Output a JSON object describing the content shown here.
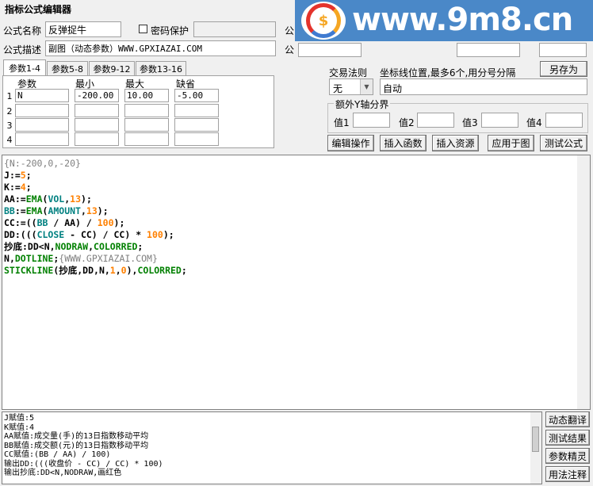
{
  "window": {
    "title": "指标公式编辑器"
  },
  "watermark": {
    "site": "www.9m8.cn"
  },
  "formula_name": {
    "label": "公式名称",
    "value": "反弹捉牛"
  },
  "password": {
    "label": "密码保护",
    "checked": false
  },
  "formula_desc": {
    "label": "公式描述",
    "value": "副图（动态参数）WWW.GPXIAZAI.COM"
  },
  "truncated_labels": {
    "top": "公",
    "mid": "公"
  },
  "tabs": [
    "参数1-4",
    "参数5-8",
    "参数9-12",
    "参数13-16"
  ],
  "params": {
    "headers": {
      "name": "参数",
      "min": "最小",
      "max": "最大",
      "default": "缺省"
    },
    "rows": [
      {
        "num": "1",
        "name": "N",
        "min": "-200.00",
        "max": "10.00",
        "default": "-5.00"
      },
      {
        "num": "2",
        "name": "",
        "min": "",
        "max": "",
        "default": ""
      },
      {
        "num": "3",
        "name": "",
        "min": "",
        "max": "",
        "default": ""
      },
      {
        "num": "4",
        "name": "",
        "min": "",
        "max": "",
        "default": ""
      }
    ]
  },
  "save_as_label": "另存为",
  "trade_rule": {
    "label": "交易法则",
    "value": "无"
  },
  "axis_pos": {
    "label": "坐标线位置,最多6个,用分号分隔",
    "value": "自动"
  },
  "extra_y": {
    "label": "额外Y轴分界",
    "v1": "值1",
    "v2": "值2",
    "v3": "值3",
    "v4": "值4"
  },
  "buttons": {
    "edit": "编辑操作",
    "insert_func": "插入函数",
    "insert_res": "插入资源",
    "apply": "应用于图",
    "test": "测试公式"
  },
  "code_lines": [
    [
      {
        "t": "{N:-200,0,-20}",
        "c": "gray"
      }
    ],
    [
      {
        "t": "J",
        "c": "black"
      },
      {
        "t": ":=",
        "c": "black"
      },
      {
        "t": "5",
        "c": "orange"
      },
      {
        "t": ";",
        "c": "black"
      }
    ],
    [
      {
        "t": "K",
        "c": "black"
      },
      {
        "t": ":=",
        "c": "black"
      },
      {
        "t": "4",
        "c": "orange"
      },
      {
        "t": ";",
        "c": "black"
      }
    ],
    [
      {
        "t": "AA",
        "c": "black"
      },
      {
        "t": ":=",
        "c": "black"
      },
      {
        "t": "EMA",
        "c": "green"
      },
      {
        "t": "(",
        "c": "black"
      },
      {
        "t": "VOL",
        "c": "teal"
      },
      {
        "t": ",",
        "c": "black"
      },
      {
        "t": "13",
        "c": "orange"
      },
      {
        "t": ");",
        "c": "black"
      }
    ],
    [
      {
        "t": "BB",
        "c": "teal"
      },
      {
        "t": ":=",
        "c": "black"
      },
      {
        "t": "EMA",
        "c": "green"
      },
      {
        "t": "(",
        "c": "black"
      },
      {
        "t": "AMOUNT",
        "c": "teal"
      },
      {
        "t": ",",
        "c": "black"
      },
      {
        "t": "13",
        "c": "orange"
      },
      {
        "t": ");",
        "c": "black"
      }
    ],
    [
      {
        "t": "CC",
        "c": "black"
      },
      {
        "t": ":=((",
        "c": "black"
      },
      {
        "t": "BB",
        "c": "teal"
      },
      {
        "t": " / AA) / ",
        "c": "black"
      },
      {
        "t": "100",
        "c": "orange"
      },
      {
        "t": ");",
        "c": "black"
      }
    ],
    [
      {
        "t": "DD",
        "c": "black"
      },
      {
        "t": ":(((",
        "c": "black"
      },
      {
        "t": "CLOSE",
        "c": "teal"
      },
      {
        "t": " - CC) / CC) * ",
        "c": "black"
      },
      {
        "t": "100",
        "c": "orange"
      },
      {
        "t": ");",
        "c": "black"
      }
    ],
    [
      {
        "t": "抄底",
        "c": "black"
      },
      {
        "t": ":DD<N,",
        "c": "black"
      },
      {
        "t": "NODRAW",
        "c": "green"
      },
      {
        "t": ",",
        "c": "black"
      },
      {
        "t": "COLORRED",
        "c": "green"
      },
      {
        "t": ";",
        "c": "black"
      }
    ],
    [
      {
        "t": "N",
        "c": "black"
      },
      {
        "t": ",",
        "c": "black"
      },
      {
        "t": "DOTLINE",
        "c": "green"
      },
      {
        "t": ";",
        "c": "black"
      },
      {
        "t": "{WWW.GPXIAZAI.COM}",
        "c": "gray"
      }
    ],
    [
      {
        "t": "STICKLINE",
        "c": "green"
      },
      {
        "t": "(",
        "c": "black"
      },
      {
        "t": "抄底",
        "c": "black"
      },
      {
        "t": ",DD,N,",
        "c": "black"
      },
      {
        "t": "1",
        "c": "orange"
      },
      {
        "t": ",",
        "c": "black"
      },
      {
        "t": "0",
        "c": "orange"
      },
      {
        "t": "),",
        "c": "black"
      },
      {
        "t": "COLORRED",
        "c": "green"
      },
      {
        "t": ";",
        "c": "black"
      }
    ]
  ],
  "output_lines": [
    "J赋值:5",
    "K赋值:4",
    "AA赋值:成交量(手)的13日指数移动平均",
    "BB赋值:成交额(元)的13日指数移动平均",
    "CC赋值:(BB / AA) / 100)",
    "输出DD:(((收盘价 - CC) / CC) * 100)",
    "输出抄底:DD<N,NODRAW,画红色"
  ],
  "side_buttons": [
    "动态翻译",
    "测试结果",
    "参数精灵",
    "用法注释"
  ],
  "colors": {
    "code_gray": "#808080",
    "code_green": "#008000",
    "code_orange": "#ff8000",
    "code_teal": "#008080"
  }
}
